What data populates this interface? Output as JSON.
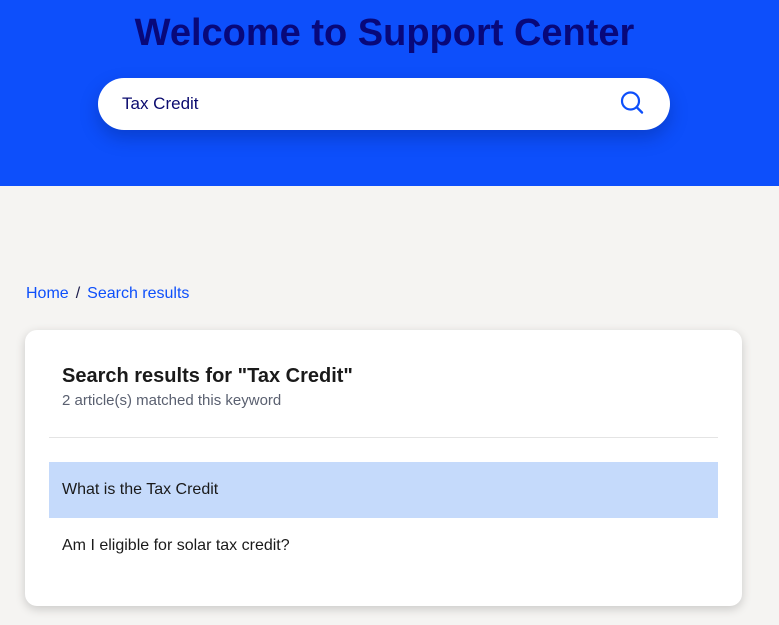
{
  "hero": {
    "title": "Welcome to Support Center"
  },
  "search": {
    "value": "Tax Credit",
    "icon": "search-icon"
  },
  "breadcrumb": {
    "home": "Home",
    "separator": "/",
    "current": "Search results"
  },
  "results": {
    "heading": "Search results for \"Tax Credit\"",
    "count_text": "2 article(s) matched this keyword",
    "items": [
      {
        "title": "What is the Tax Credit",
        "highlighted": true
      },
      {
        "title": "Am I eligible for solar tax credit?",
        "highlighted": false
      }
    ]
  },
  "colors": {
    "brand_blue": "#0d4ffb",
    "title_navy": "#08087a",
    "highlight": "#c5dafb",
    "page_bg": "#f5f4f2"
  }
}
